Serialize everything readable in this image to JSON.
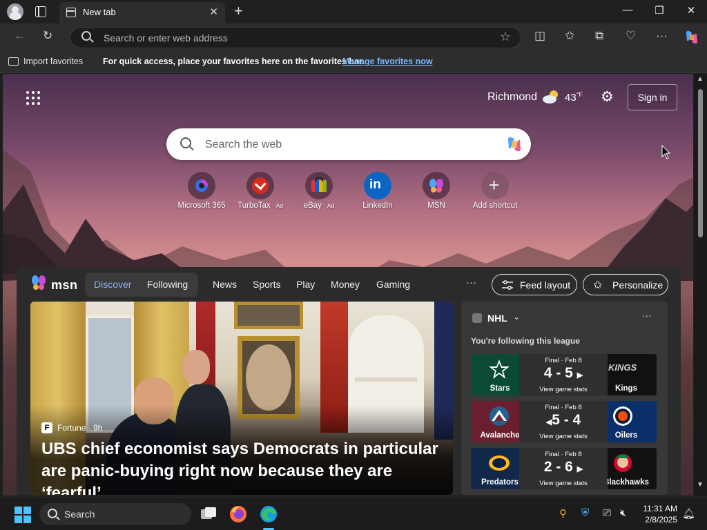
{
  "browser": {
    "tab_title": "New tab",
    "address_placeholder": "Search or enter web address"
  },
  "favorites_bar": {
    "import_label": "Import favorites",
    "message": "For quick access, place your favorites here on the favorites bar.",
    "manage_link": "Manage favorites now"
  },
  "header": {
    "location": "Richmond",
    "temperature": "43",
    "temp_unit": "°F",
    "signin_label": "Sign in"
  },
  "search": {
    "placeholder": "Search the web"
  },
  "shortcuts": [
    {
      "label": "Microsoft 365",
      "ad": ""
    },
    {
      "label": "TurboTax",
      "ad": "· Ad"
    },
    {
      "label": "eBay",
      "ad": "· Ad"
    },
    {
      "label": "LinkedIn",
      "ad": ""
    },
    {
      "label": "MSN",
      "ad": ""
    },
    {
      "label": "Add shortcut",
      "ad": ""
    }
  ],
  "msn": {
    "logo_text": "msn",
    "segments": {
      "discover": "Discover",
      "following": "Following"
    },
    "nav": [
      "News",
      "Sports",
      "Play",
      "Money",
      "Gaming"
    ],
    "more": "···",
    "feed_layout_label": "Feed layout",
    "personalize_label": "Personalize"
  },
  "hero": {
    "source_letter": "F",
    "source": "Fortune · 9h",
    "title": "UBS chief economist says Democrats in particular are panic-buying right now because they are ‘fearful’..."
  },
  "nhl": {
    "title": "NHL",
    "more": "···",
    "subtitle": "You're following this league",
    "games": [
      {
        "status": "Final · Feb 8",
        "score": "4 - 5",
        "stats": "View game stats",
        "home": "Stars",
        "away": "Kings",
        "left_color": "#0b4a36",
        "right_color": "#111111",
        "arrow": "right"
      },
      {
        "status": "Final · Feb 8",
        "score": "5 - 4",
        "stats": "View game stats",
        "home": "Avalanche",
        "away": "Oilers",
        "left_color": "#6b1f2e",
        "right_color": "#0b2f6b",
        "arrow": "left"
      },
      {
        "status": "Final · Feb 8",
        "score": "2 - 6",
        "stats": "View game stats",
        "home": "Predators",
        "away": "Blackhawks",
        "left_color": "#12284a",
        "right_color": "#111111",
        "arrow": "right"
      }
    ]
  },
  "taskbar": {
    "search_label": "Search",
    "time": "11:31 AM",
    "date": "2/8/2025"
  },
  "colors": {
    "accent": "#8ab4f8",
    "link": "#79b8ff",
    "start": "#4cc2ff"
  }
}
